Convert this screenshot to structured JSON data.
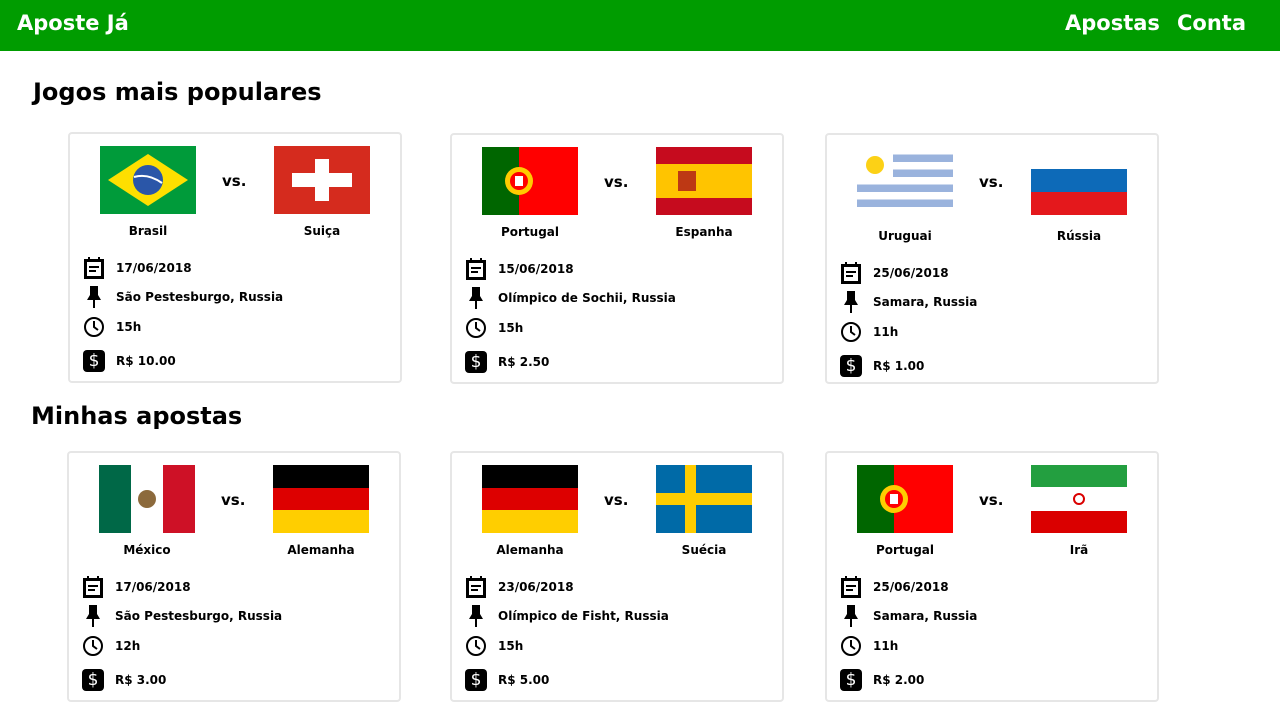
{
  "nav": {
    "brand": "Aposte Já",
    "links": [
      "Apostas",
      "Conta"
    ]
  },
  "sections": [
    {
      "title": "Jogos mais populares",
      "games": [
        {
          "home": "Brasil",
          "home_flag": "br",
          "away": "Suiça",
          "away_flag": "ch",
          "vs": "vs.",
          "date": "17/06/2018",
          "venue": "São Pestesburgo, Russia",
          "time": "15h",
          "price": "R$ 10.00"
        },
        {
          "home": "Portugal",
          "home_flag": "pt",
          "away": "Espanha",
          "away_flag": "es",
          "vs": "vs.",
          "date": "15/06/2018",
          "venue": "Olímpico de Sochii, Russia",
          "time": "15h",
          "price": "R$ 2.50"
        },
        {
          "home": "Uruguai",
          "home_flag": "uy",
          "away": "Rússia",
          "away_flag": "ru",
          "vs": "vs.",
          "date": "25/06/2018",
          "venue": "Samara, Russia",
          "time": "11h",
          "price": "R$ 1.00"
        }
      ]
    },
    {
      "title": "Minhas apostas",
      "games": [
        {
          "home": "México",
          "home_flag": "mx",
          "away": "Alemanha",
          "away_flag": "de",
          "vs": "vs.",
          "date": "17/06/2018",
          "venue": "São Pestesburgo, Russia",
          "time": "12h",
          "price": "R$ 3.00"
        },
        {
          "home": "Alemanha",
          "home_flag": "de",
          "away": "Suécia",
          "away_flag": "se",
          "vs": "vs.",
          "date": "23/06/2018",
          "venue": "Olímpico de Fisht, Russia",
          "time": "15h",
          "price": "R$ 5.00"
        },
        {
          "home": "Portugal",
          "home_flag": "pt",
          "away": "Irã",
          "away_flag": "ir",
          "vs": "vs.",
          "date": "25/06/2018",
          "venue": "Samara, Russia",
          "time": "11h",
          "price": "R$ 2.00"
        }
      ]
    }
  ],
  "colors": {
    "nav": "#009c00"
  }
}
